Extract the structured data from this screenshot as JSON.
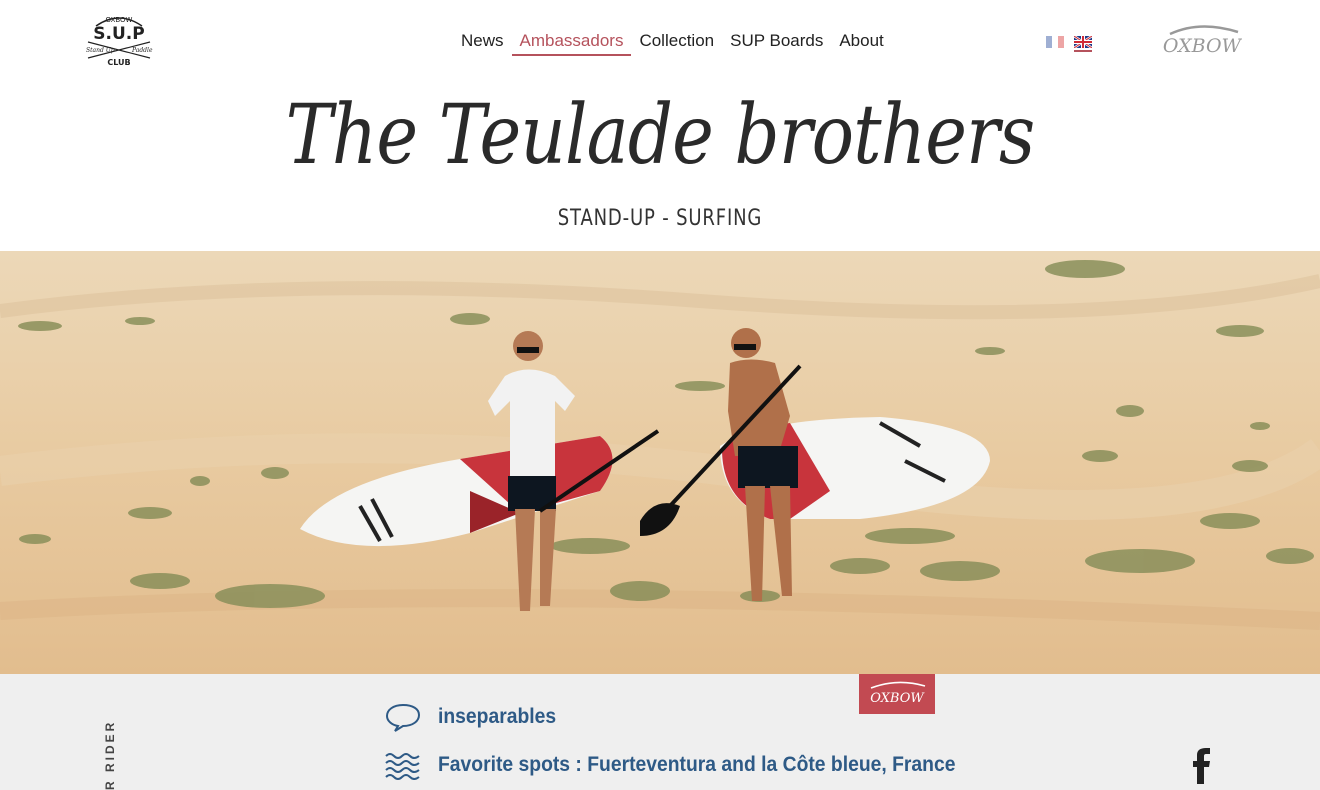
{
  "header": {
    "nav": [
      {
        "label": "News",
        "active": false
      },
      {
        "label": "Ambassadors",
        "active": true
      },
      {
        "label": "Collection",
        "active": false
      },
      {
        "label": "SUP Boards",
        "active": false
      },
      {
        "label": "About",
        "active": false
      }
    ],
    "logo_text": {
      "top": "OXBOW",
      "main": "S.U.P",
      "left": "Stand Up",
      "right": "Paddle",
      "bottom": "CLUB"
    },
    "brand": "OXBOW",
    "languages": [
      "fr",
      "en"
    ],
    "active_language": "en"
  },
  "hero": {
    "title": "The Teulade brothers",
    "subtitle": "STAND-UP - SURFING"
  },
  "details": {
    "vertical_label": "R RIDER",
    "items": [
      {
        "icon": "speech-bubble-icon",
        "text": "inseparables"
      },
      {
        "icon": "waves-icon",
        "text": "Favorite spots : Fuerteventura and la Côte bleue, France"
      }
    ],
    "badge": "OXBOW"
  },
  "colors": {
    "accent": "#b5525c",
    "link_blue": "#2e5a86",
    "footer_bg": "#efefef",
    "sand": "#e8cfa6"
  }
}
